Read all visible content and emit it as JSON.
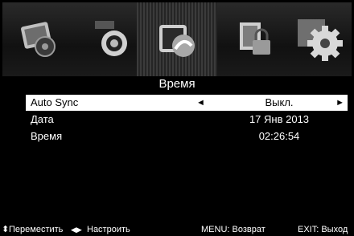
{
  "header": {
    "icons": [
      {
        "name": "picture-icon",
        "selected": false
      },
      {
        "name": "sound-icon",
        "selected": false
      },
      {
        "name": "time-icon",
        "selected": true
      },
      {
        "name": "lock-icon",
        "selected": false
      },
      {
        "name": "setup-icon",
        "selected": false
      }
    ],
    "title": "Время"
  },
  "menu": {
    "items": [
      {
        "label": "Auto Sync",
        "value": "Выкл.",
        "highlighted": true,
        "arrow_left": "◄",
        "arrow_right": "►"
      },
      {
        "label": "Дата",
        "value": "17 Янв 2013",
        "highlighted": false
      },
      {
        "label": "Время",
        "value": "02:26:54",
        "highlighted": false
      }
    ]
  },
  "footer": {
    "move_icon": "⬍",
    "move_label": "Переместить",
    "adjust_icon": "◀▶",
    "adjust_label": "Настроить",
    "menu_label": "MENU: Возврат",
    "exit_label": "EXIT: Выход"
  },
  "colors": {
    "background": "#000000",
    "highlight": "#ffffff",
    "text": "#ffffff"
  }
}
